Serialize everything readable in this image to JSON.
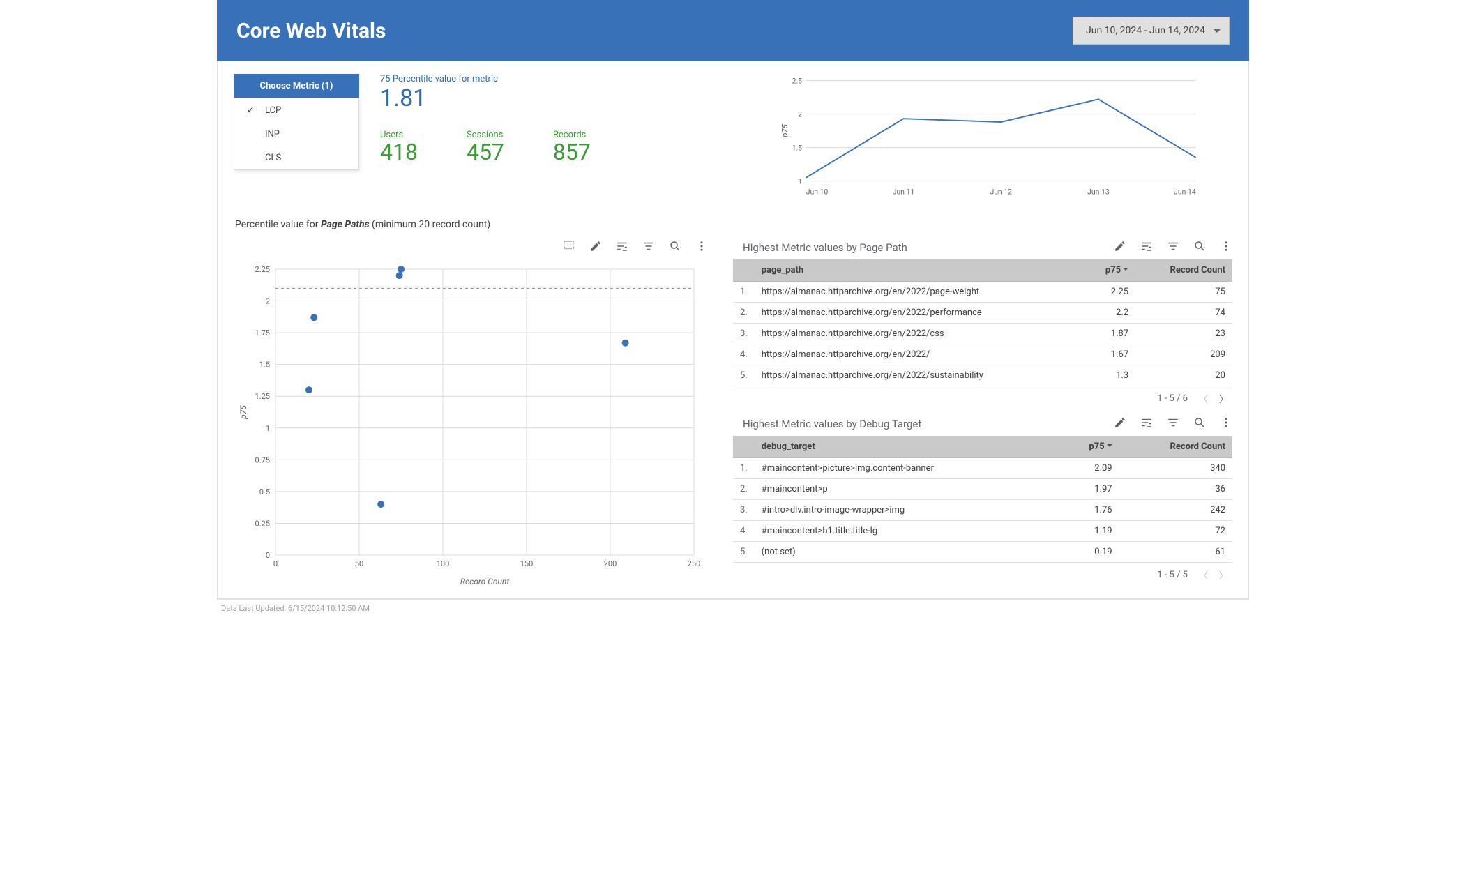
{
  "header": {
    "title": "Core Web Vitals",
    "date_range": "Jun 10, 2024 - Jun 14, 2024"
  },
  "metric_picker": {
    "header": "Choose Metric (1)",
    "items": [
      {
        "label": "LCP",
        "selected": true
      },
      {
        "label": "INP",
        "selected": false
      },
      {
        "label": "CLS",
        "selected": false
      }
    ]
  },
  "percentile": {
    "label": "75 Percentile value for metric",
    "value": "1.81"
  },
  "kpis": {
    "users": {
      "label": "Users",
      "value": "418"
    },
    "sessions": {
      "label": "Sessions",
      "value": "457"
    },
    "records": {
      "label": "Records",
      "value": "857"
    }
  },
  "chart_data": [
    {
      "id": "p75_line",
      "type": "line",
      "title": "",
      "ylabel": "p75",
      "xlabel": "",
      "categories": [
        "Jun 10",
        "Jun 11",
        "Jun 12",
        "Jun 13",
        "Jun 14"
      ],
      "values": [
        1.05,
        1.93,
        1.88,
        2.22,
        1.35
      ],
      "ylim": [
        1,
        2.5
      ],
      "yticks": [
        1,
        1.5,
        2,
        2.5
      ]
    },
    {
      "id": "scatter_pagepaths",
      "type": "scatter",
      "title": "Percentile value for Page Paths (minimum 20 record count)",
      "xlabel": "Record Count",
      "ylabel": "p75",
      "xlim": [
        0,
        250
      ],
      "ylim": [
        0,
        2.25
      ],
      "xticks": [
        0,
        50,
        100,
        150,
        200,
        250
      ],
      "yticks": [
        0,
        0.25,
        0.5,
        0.75,
        1,
        1.25,
        1.5,
        1.75,
        2,
        2.25
      ],
      "threshold_y": 2.1,
      "points": [
        {
          "x": 75,
          "y": 2.25
        },
        {
          "x": 74,
          "y": 2.2
        },
        {
          "x": 23,
          "y": 1.87
        },
        {
          "x": 209,
          "y": 1.67
        },
        {
          "x": 20,
          "y": 1.3
        },
        {
          "x": 63,
          "y": 0.4
        }
      ]
    }
  ],
  "section_label": {
    "prefix": "Percentile value for ",
    "italic": "Page Paths",
    "suffix": " (minimum 20 record count)"
  },
  "tables": {
    "page_path": {
      "title": "Highest Metric values by Page Path",
      "cols": {
        "a": "page_path",
        "b": "p75",
        "c": "Record Count"
      },
      "rows": [
        {
          "i": "1.",
          "a": "https://almanac.httparchive.org/en/2022/page-weight",
          "b": "2.25",
          "c": "75"
        },
        {
          "i": "2.",
          "a": "https://almanac.httparchive.org/en/2022/performance",
          "b": "2.2",
          "c": "74"
        },
        {
          "i": "3.",
          "a": "https://almanac.httparchive.org/en/2022/css",
          "b": "1.87",
          "c": "23"
        },
        {
          "i": "4.",
          "a": "https://almanac.httparchive.org/en/2022/",
          "b": "1.67",
          "c": "209"
        },
        {
          "i": "5.",
          "a": "https://almanac.httparchive.org/en/2022/sustainability",
          "b": "1.3",
          "c": "20"
        }
      ],
      "pager": "1 - 5 / 6"
    },
    "debug_target": {
      "title": "Highest Metric values by Debug Target",
      "cols": {
        "a": "debug_target",
        "b": "p75",
        "c": "Record Count"
      },
      "rows": [
        {
          "i": "1.",
          "a": "#maincontent>picture>img.content-banner",
          "b": "2.09",
          "c": "340"
        },
        {
          "i": "2.",
          "a": "#maincontent>p",
          "b": "1.97",
          "c": "36"
        },
        {
          "i": "3.",
          "a": "#intro>div.intro-image-wrapper>img",
          "b": "1.76",
          "c": "242"
        },
        {
          "i": "4.",
          "a": "#maincontent>h1.title.title-lg",
          "b": "1.19",
          "c": "72"
        },
        {
          "i": "5.",
          "a": "(not set)",
          "b": "0.19",
          "c": "61"
        }
      ],
      "pager": "1 - 5 / 5"
    }
  },
  "footer": "Data Last Updated: 6/15/2024 10:12:50 AM"
}
